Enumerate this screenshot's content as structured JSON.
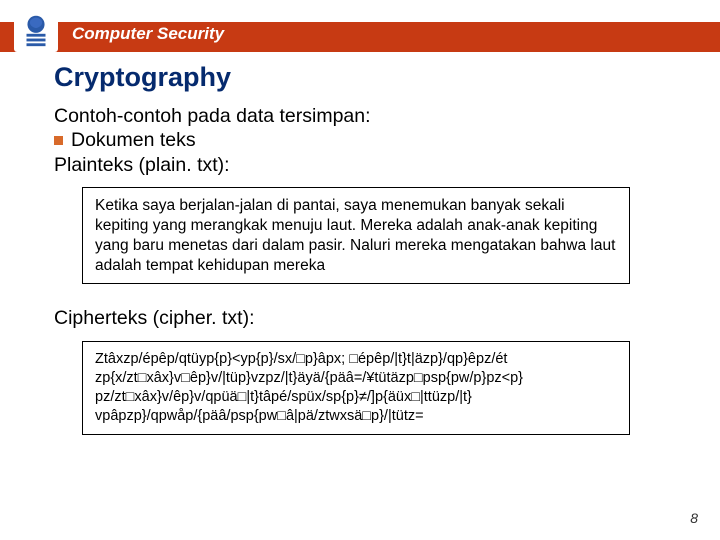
{
  "header": {
    "course_title": "Computer Security"
  },
  "slide": {
    "title": "Cryptography",
    "intro": "Contoh-contoh pada data tersimpan:",
    "bullet1": "Dokumen teks",
    "plaintext_label": "Plainteks (plain. txt):",
    "plaintext_box": "Ketika saya berjalan-jalan di pantai, saya menemukan banyak sekali kepiting yang merangkak menuju laut. Mereka adalah anak-anak kepiting yang baru menetas dari dalam pasir. Naluri mereka mengatakan bahwa laut adalah tempat kehidupan mereka",
    "ciphertext_label": "Cipherteks (cipher. txt):",
    "ciphertext_box": "Ztâxzp/épêp/qtüyp{p}<yp{p}/sx/□p}âpx; □épêp/|t}t|äzp}/qp}êpz/ét\nzp{x/zt□xâx}v□êp}v/|tüp}vzpz/|t}äyä/{päâ=/¥tütäzp□psp{pw/p}pz<p}\npz/zt□xâx}v/êp}v/qpüä□|t}tâpé/spüx/sp{p}≠/]p{äüx□|ttüzp/|t}\nvpâpzp}/qpwåp/{päâ/psp{pw□â|pä/ztwxsä□p}/|tütz=",
    "page_number": "8"
  }
}
